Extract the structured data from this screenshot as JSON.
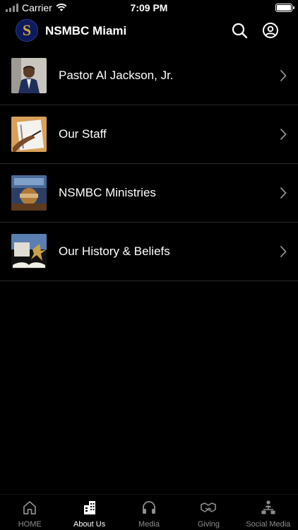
{
  "status_bar": {
    "carrier": "Carrier",
    "time": "7:09 PM"
  },
  "header": {
    "logo_letter": "S",
    "title": "NSMBC Miami"
  },
  "menu_items": [
    {
      "label": "Pastor Al Jackson, Jr."
    },
    {
      "label": "Our Staff"
    },
    {
      "label": "NSMBC Ministries"
    },
    {
      "label": "Our History & Beliefs"
    }
  ],
  "tabs": [
    {
      "label": "HOME",
      "icon": "home-icon",
      "active": false
    },
    {
      "label": "About Us",
      "icon": "building-icon",
      "active": true
    },
    {
      "label": "Media",
      "icon": "headphones-icon",
      "active": false
    },
    {
      "label": "Giving",
      "icon": "handshake-icon",
      "active": false
    },
    {
      "label": "Social Media",
      "icon": "network-icon",
      "active": false
    }
  ],
  "colors": {
    "background": "#000000",
    "active_tab": "#ffffff",
    "inactive_tab": "#8e8e8e",
    "logo_bg": "#0d1a5c",
    "logo_gold": "#d6a73b"
  }
}
